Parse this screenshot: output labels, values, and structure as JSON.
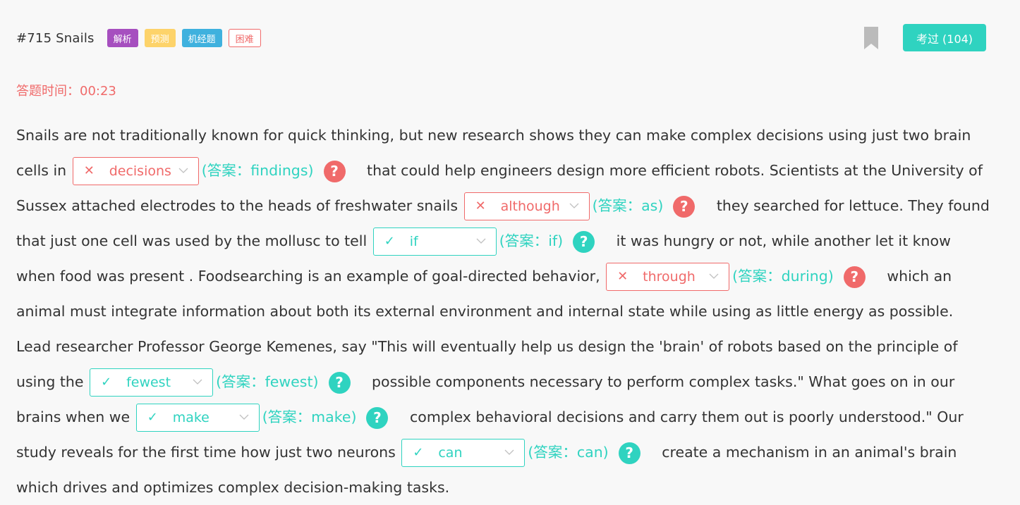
{
  "question": {
    "title": "#715 Snails"
  },
  "tags": [
    "解析",
    "预测",
    "机经题",
    "困难"
  ],
  "passed_button": "考过 (104)",
  "timer": "答题时间：00:23",
  "icons": {
    "bookmark": "bookmark-icon",
    "wrong": "cross-icon",
    "right": "check-icon",
    "dropdown": "chevron-down-icon",
    "help": "question-circle-icon"
  },
  "colors": {
    "accent": "#2fd3c0",
    "error": "#f06a6a",
    "tag_purple": "#a64fbf",
    "tag_yellow": "#fdd36a",
    "tag_blue": "#3fb1de",
    "bookmark": "#bbbbbb"
  },
  "passage": {
    "t0": "Snails are not traditionally known for quick thinking, but new research shows they can make complex decisions using just two brain cells in",
    "t1": " that could help engineers design more efficient robots. Scientists at the University of Sussex attached electrodes to the heads of freshwater snails",
    "t2": " they searched for lettuce. They found that just one cell was used by the mollusc to tell",
    "t3": " it was hungry or not, while another let it know when food was present . Foodsearching is an example of goal-directed behavior,",
    "t4": " which an animal must integrate information about both its external environment and internal state while using as little energy as possible. Lead researcher Professor George Kemenes, say \"This will eventually help us design the 'brain' of robots based on the principle of using the",
    "t5": " possible components necessary to perform complex tasks.\" What goes on in our brains when we",
    "t6": " complex behavioral decisions and carry them out is poorly understood.\" Our study reveals for the first time how just two neurons",
    "t7": " create a mechanism in an animal's brain which drives and optimizes complex decision-making tasks."
  },
  "gaps": [
    {
      "selected": "decisions",
      "mark": "✕",
      "answer": "(答案：findings)",
      "help": "?"
    },
    {
      "selected": "although",
      "mark": "✕",
      "answer": "(答案：as)",
      "help": "?"
    },
    {
      "selected": "if",
      "mark": "✓",
      "answer": "(答案：if)",
      "help": "?"
    },
    {
      "selected": "through",
      "mark": "✕",
      "answer": "(答案：during)",
      "help": "?"
    },
    {
      "selected": "fewest",
      "mark": "✓",
      "answer": "(答案：fewest)",
      "help": "?"
    },
    {
      "selected": "make",
      "mark": "✓",
      "answer": "(答案：make)",
      "help": "?"
    },
    {
      "selected": "can",
      "mark": "✓",
      "answer": "(答案：can)",
      "help": "?"
    }
  ]
}
